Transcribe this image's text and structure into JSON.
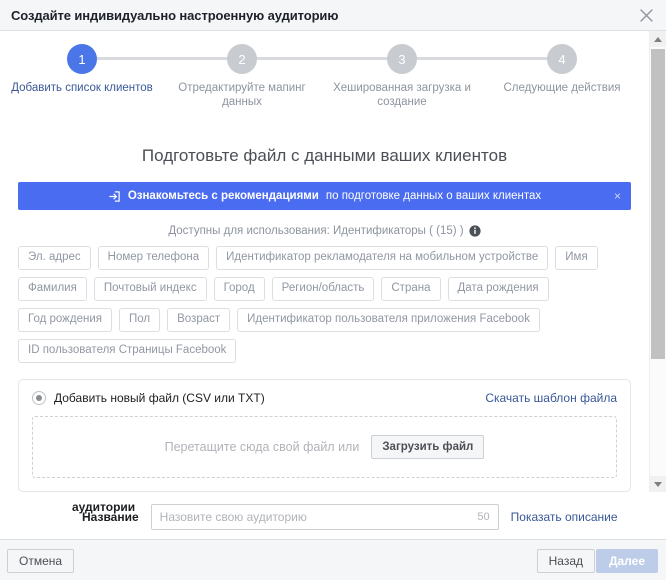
{
  "window": {
    "title": "Создайте индивидуально настроенную аудиторию",
    "close_icon": "close-icon"
  },
  "stepper": {
    "steps": [
      {
        "number": "1",
        "label": "Добавить список клиентов",
        "state": "active"
      },
      {
        "number": "2",
        "label": "Отредактируйте мапинг данных",
        "state": "inactive"
      },
      {
        "number": "3",
        "label": "Хешированная загрузка и создание",
        "state": "inactive"
      },
      {
        "number": "4",
        "label": "Следующие действия",
        "state": "inactive"
      }
    ],
    "active_color": "#4a76e8",
    "inactive_color": "#c8cbcf",
    "active_label_color": "#3b5998"
  },
  "main": {
    "heading": "Подготовьте файл с данными ваших клиентов"
  },
  "banner": {
    "icon": "arrow-into-box-icon",
    "strong_text": "Ознакомьтесь с рекомендациями",
    "rest_text": "по подготовке данных о ваших клиентах",
    "close_label": "×",
    "background": "#4a6cf0"
  },
  "identifiers": {
    "heading": "Доступны для использования: Идентификаторы ( (15) )",
    "info_icon": "info-icon",
    "tags": [
      "Эл. адрес",
      "Номер телефона",
      "Идентификатор рекламодателя на мобильном устройстве",
      "Имя",
      "Фамилия",
      "Почтовый индекс",
      "Город",
      "Регион/область",
      "Страна",
      "Дата рождения",
      "Год рождения",
      "Пол",
      "Возраст",
      "Идентификатор пользователя приложения Facebook",
      "ID пользователя Страницы Facebook"
    ]
  },
  "upload": {
    "radio_label": "Добавить новый файл (CSV или TXT)",
    "radio_checked": true,
    "template_link": "Скачать шаблон файла",
    "dropzone_text": "Перетащите сюда свой файл или",
    "upload_button": "Загрузить файл"
  },
  "name_section": {
    "label": "Название",
    "placeholder": "Назовите свою аудиторию",
    "value": "",
    "char_count": "50",
    "description_link": "Показать описание"
  },
  "footer": {
    "stray_text": "аудитории",
    "cancel_label": "Отмена",
    "back_label": "Назад",
    "next_label": "Далее",
    "next_disabled": true,
    "next_color": "#bdcce8"
  },
  "scrollbar": {
    "up_icon": "caret-up-icon",
    "down_icon": "caret-down-icon",
    "thumb_color": "#c1c1c1"
  }
}
